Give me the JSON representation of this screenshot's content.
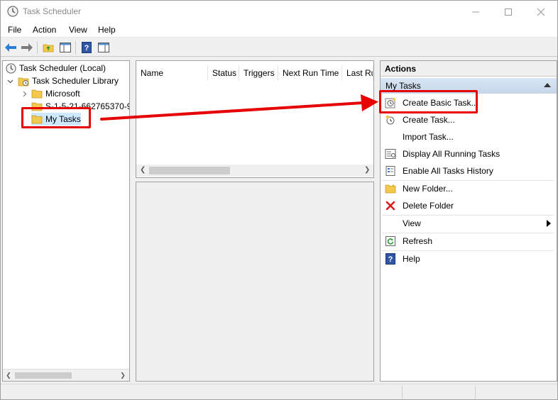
{
  "window": {
    "title": "Task Scheduler"
  },
  "menu": {
    "items": [
      "File",
      "Action",
      "View",
      "Help"
    ]
  },
  "tree": {
    "root": "Task Scheduler (Local)",
    "library": "Task Scheduler Library",
    "children": [
      "Microsoft",
      "S-1-5-21-662765370-9",
      "My Tasks"
    ]
  },
  "task_list": {
    "columns": [
      "Name",
      "Status",
      "Triggers",
      "Next Run Time",
      "Last Ru"
    ]
  },
  "actions": {
    "header": "Actions",
    "group": "My Tasks",
    "items": [
      {
        "label": "Create Basic Task...",
        "icon": "create-basic-task-icon"
      },
      {
        "label": "Create Task...",
        "icon": "create-task-icon"
      },
      {
        "label": "Import Task...",
        "icon": ""
      },
      {
        "label": "Display All Running Tasks",
        "icon": "running-tasks-icon"
      },
      {
        "label": "Enable All Tasks History",
        "icon": "history-icon"
      },
      {
        "label": "New Folder...",
        "icon": "new-folder-icon"
      },
      {
        "label": "Delete Folder",
        "icon": "delete-icon"
      },
      {
        "label": "View",
        "icon": ""
      },
      {
        "label": "Refresh",
        "icon": "refresh-icon"
      },
      {
        "label": "Help",
        "icon": "help-icon"
      }
    ]
  },
  "colors": {
    "annotation": "#e60000",
    "selection_group": "#c6d7ea",
    "folder": "#f2c94c"
  }
}
